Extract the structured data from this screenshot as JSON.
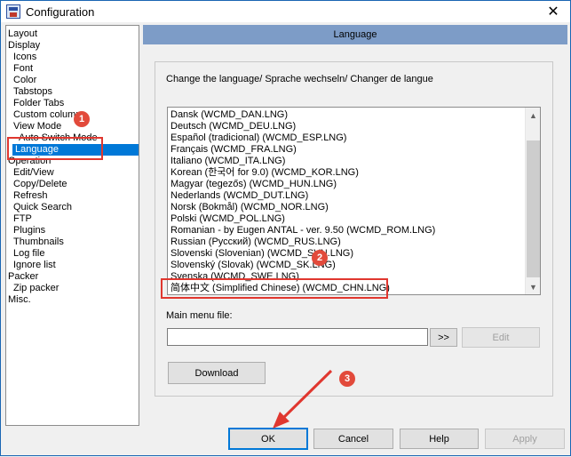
{
  "window": {
    "title": "Configuration",
    "close_glyph": "✕"
  },
  "tree": {
    "items": [
      {
        "label": "Layout",
        "indent": 0
      },
      {
        "label": "Display",
        "indent": 0
      },
      {
        "label": "Icons",
        "indent": 1
      },
      {
        "label": "Font",
        "indent": 1
      },
      {
        "label": "Color",
        "indent": 1
      },
      {
        "label": "Tabstops",
        "indent": 1
      },
      {
        "label": "Folder Tabs",
        "indent": 1
      },
      {
        "label": "Custom columns",
        "indent": 1
      },
      {
        "label": "View Mode",
        "indent": 1
      },
      {
        "label": "Auto Switch Mode",
        "indent": 2
      },
      {
        "label": "Language",
        "indent": 1,
        "selected": true
      },
      {
        "label": "Operation",
        "indent": 0
      },
      {
        "label": "Edit/View",
        "indent": 1
      },
      {
        "label": "Copy/Delete",
        "indent": 1
      },
      {
        "label": "Refresh",
        "indent": 1
      },
      {
        "label": "Quick Search",
        "indent": 1
      },
      {
        "label": "FTP",
        "indent": 1
      },
      {
        "label": "Plugins",
        "indent": 1
      },
      {
        "label": "Thumbnails",
        "indent": 1
      },
      {
        "label": "Log file",
        "indent": 1
      },
      {
        "label": "Ignore list",
        "indent": 1
      },
      {
        "label": "Packer",
        "indent": 0
      },
      {
        "label": "Zip packer",
        "indent": 1
      },
      {
        "label": "Misc.",
        "indent": 0
      }
    ]
  },
  "panel": {
    "header": "Language",
    "change_label": "Change the language/ Sprache wechseln/ Changer de langue",
    "languages": [
      "Dansk (WCMD_DAN.LNG)",
      "Deutsch (WCMD_DEU.LNG)",
      "Español (tradicional) (WCMD_ESP.LNG)",
      "Français (WCMD_FRA.LNG)",
      "Italiano (WCMD_ITA.LNG)",
      "Korean (한국어 for 9.0) (WCMD_KOR.LNG)",
      "Magyar (tegezős) (WCMD_HUN.LNG)",
      "Nederlands (WCMD_DUT.LNG)",
      "Norsk (Bokmål) (WCMD_NOR.LNG)",
      "Polski (WCMD_POL.LNG)",
      "Romanian - by Eugen ANTAL - ver. 9.50 (WCMD_ROM.LNG)",
      "Russian (Русский) (WCMD_RUS.LNG)",
      "Slovenski (Slovenian) (WCMD_SVN.LNG)",
      "Slovenský (Slovak) (WCMD_SK.LNG)",
      "Svenska (WCMD_SWE.LNG)",
      "简体中文 (Simplified Chinese) (WCMD_CHN.LNG)"
    ],
    "main_menu_label": "Main menu file:",
    "main_menu_value": "",
    "browse_label": ">>",
    "edit_label": "Edit",
    "download_label": "Download"
  },
  "footer": {
    "ok": "OK",
    "cancel": "Cancel",
    "help": "Help",
    "apply": "Apply"
  },
  "annotations": {
    "badge1": "1",
    "badge2": "2",
    "badge3": "3",
    "color": "#e0372f"
  },
  "scroll": {
    "up": "▲",
    "down": "▼"
  }
}
